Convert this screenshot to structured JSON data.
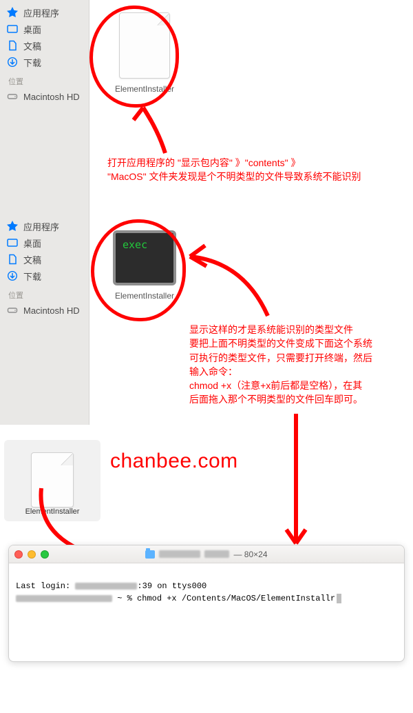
{
  "sidebar": {
    "apps": "应用程序",
    "desktop": "桌面",
    "documents": "文稿",
    "downloads": "下载",
    "section_locations": "位置",
    "macintosh_hd": "Macintosh HD"
  },
  "files": {
    "elementinstaller_label": "ElementInstaller",
    "exec_text": "exec"
  },
  "annotations": {
    "block1_line1": "打开应用程序的 \"显示包内容\" 》\"contents\" 》",
    "block1_line2": "\"MacOS\" 文件夹发现是个不明类型的文件导致系统不能识别",
    "block2_line1": "显示这样的才是系统能识别的类型文件",
    "block2_line2": "要把上面不明类型的文件变成下面这个系统",
    "block2_line3": "可执行的类型文件，只需要打开终端，然后",
    "block2_line4": "输入命令：",
    "block2_line5": "chmod +x（注意+x前后都是空格），在其",
    "block2_line6": "后面拖入那个不明类型的文件回车即可。",
    "watermark": "chanbee.com"
  },
  "terminal": {
    "title_suffix": "— 80×24",
    "line1_prefix": "Last login: ",
    "line1_suffix": ":39 on ttys000",
    "line2_mid": " ~ % ",
    "line2_cmd": "chmod +x /Contents/MacOS/ElementInstallr"
  }
}
